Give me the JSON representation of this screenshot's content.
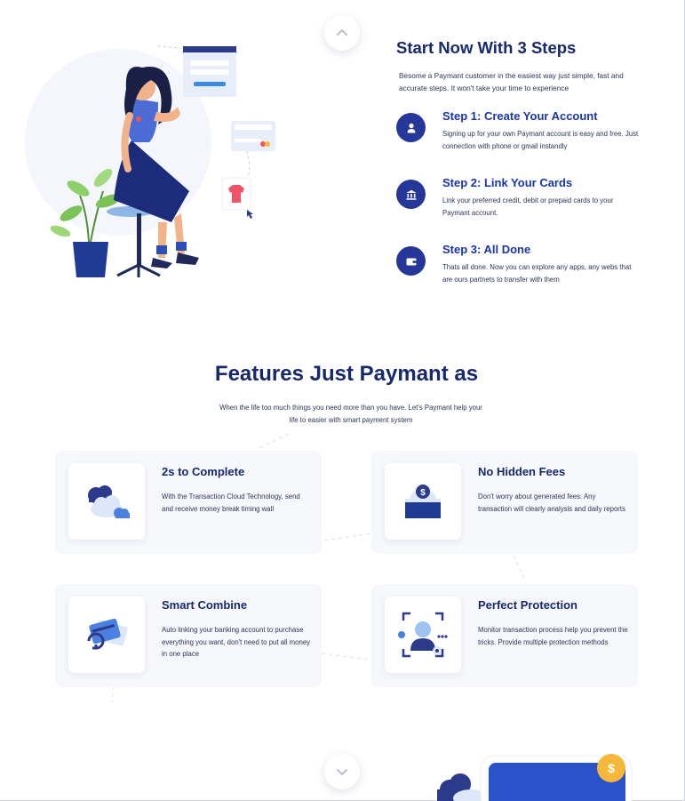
{
  "steps_section": {
    "title": "Start Now With 3 Steps",
    "subtitle": "Besome a Paymant customer in the easiest way just simple, fast and accurate steps. It won't take your time to experience",
    "steps": [
      {
        "title": "Step 1:  Create Your Account",
        "text": "Signing up for your own Paymant account is easy and free. Just connection with phone or gmail instandly",
        "icon": "user-icon"
      },
      {
        "title": "Step 2:  Link Your Cards",
        "text": "Link your preferred credit, debit or prepaid cards to your Paymant account.",
        "icon": "bank-icon"
      },
      {
        "title": "Step 3:  All Done",
        "text": "Thats all done. Now you can explore any apps, any webs that are ours partnets to transfer with them",
        "icon": "wallet-icon"
      }
    ]
  },
  "features_section": {
    "title": "Features Just Paymant as",
    "subtitle": "When the life too much things you need more than you have. Let's Paymant help your life to easier with smart payment system",
    "cards": [
      {
        "title": "2s to Complete",
        "text": "With the Transaction Cloud Technology, send and receive money break timing wall",
        "icon": "cloud-icon"
      },
      {
        "title": "No Hidden Fees",
        "text": "Don't worry about generated fees. Any transaction will clearly analysis and daily reports",
        "icon": "money-bag-icon"
      },
      {
        "title": "Smart Combine",
        "text": "Auto linking your banking account to purchase everything you want, don't need to put all money in one place",
        "icon": "cards-icon"
      },
      {
        "title": "Perfect Protection",
        "text": "Monitor transaction process help you prevent the tricks. Provide multiple protection methods",
        "icon": "face-scan-icon"
      }
    ]
  },
  "colors": {
    "primary": "#25389a",
    "heading": "#17296b",
    "accent_blue": "#1a35a8",
    "card_bg": "#f6f8fc",
    "coin": "#f6b83a"
  }
}
